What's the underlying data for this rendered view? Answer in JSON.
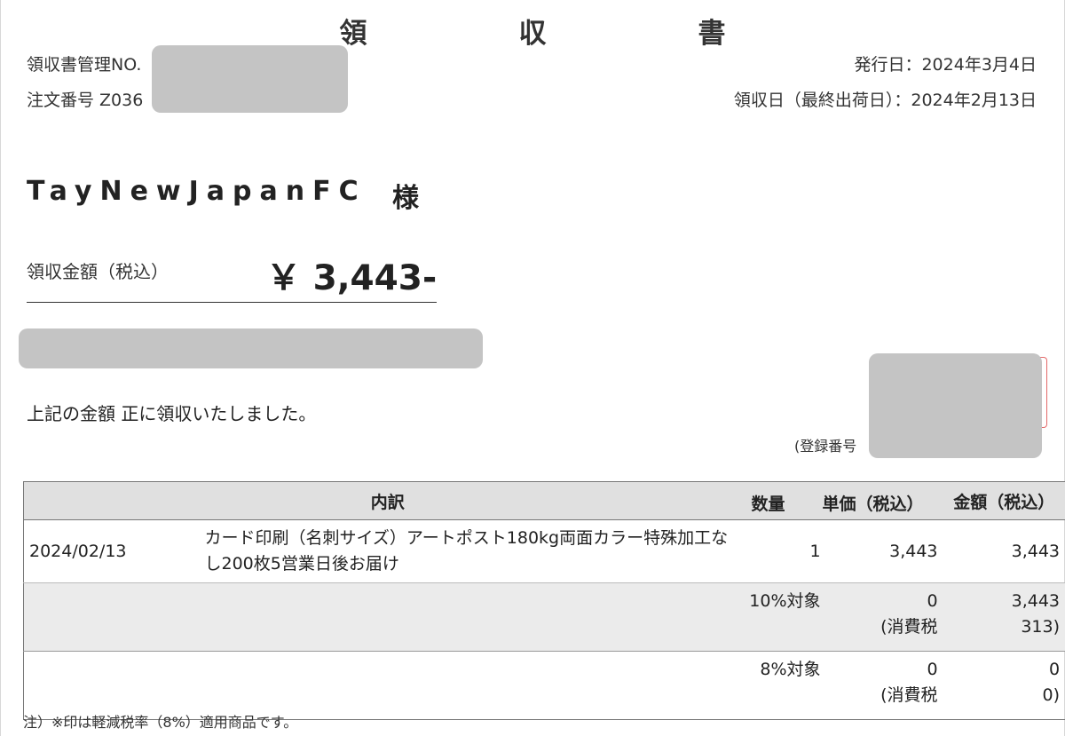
{
  "title": "領　収　書",
  "header": {
    "receipt_no_label": "領収書管理NO.",
    "order_no_label": "注文番号 Z036",
    "issue_date": "発行日：2024年3月4日",
    "receipt_date": "領収日（最終出荷日）：2024年2月13日"
  },
  "customer": {
    "name": "TayNewJapanFC",
    "honorific": "様"
  },
  "amount": {
    "label": "領収金額（税込）",
    "value": "￥ 3,443-"
  },
  "acknowledgement": "上記の金額 正に領収いたしました。",
  "registration_label": "(登録番号",
  "table": {
    "headers": {
      "breakdown": "内訳",
      "quantity": "数量",
      "unit_price": "単価（税込）",
      "amount": "金額（税込）"
    },
    "item": {
      "date": "2024/02/13",
      "description": "カード印刷（名刺サイズ）アートポスト180kg両面カラー特殊加工なし200枚5営業日後お届け",
      "quantity": "1",
      "unit_price": "3,443",
      "amount": "3,443"
    },
    "tax_rows": [
      {
        "label": "10%対象",
        "unit_line1": "0",
        "unit_line2": "(消費税",
        "amount_line1": "3,443",
        "amount_line2": "313)"
      },
      {
        "label": "8%対象",
        "unit_line1": "0",
        "unit_line2": "(消費税",
        "amount_line1": "0",
        "amount_line2": "0)"
      }
    ]
  },
  "footnote": "注）※印は軽減税率（8%）適用商品です。",
  "colors": {
    "redaction": "#c4c4c4",
    "header_bg": "#e0e0e0",
    "shaded_row": "#ebebeb",
    "stamp_red": "#e46a6a"
  }
}
